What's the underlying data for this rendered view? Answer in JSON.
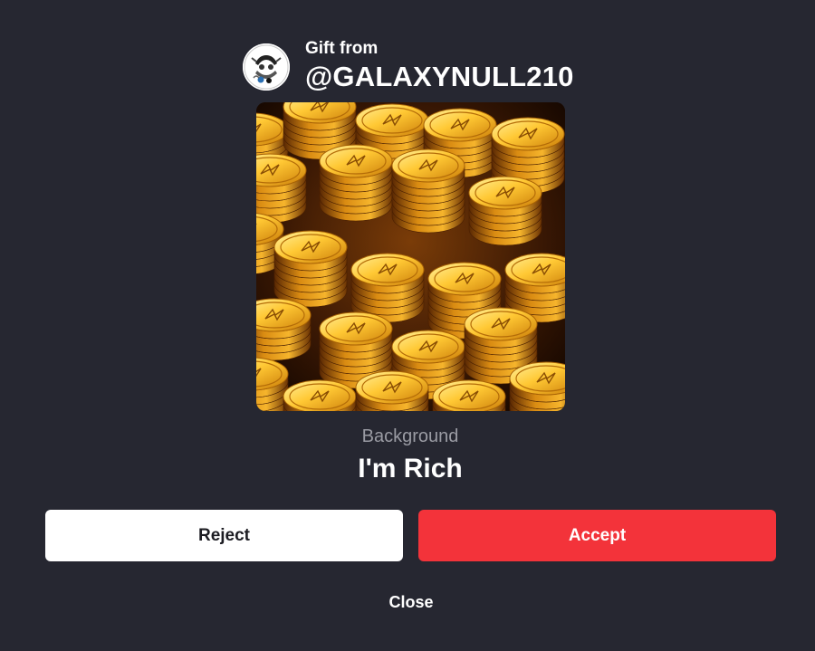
{
  "header": {
    "gift_from_label": "Gift from",
    "sender_name": "@GALAXYNULL210",
    "avatar_icon": "user-avatar-icon"
  },
  "item": {
    "type_label": "Background",
    "name": "I'm Rich",
    "image_icon": "gold-coins-background-image"
  },
  "actions": {
    "reject_label": "Reject",
    "accept_label": "Accept",
    "close_label": "Close"
  },
  "colors": {
    "background": "#262731",
    "accept": "#f3333a",
    "reject": "#ffffff",
    "muted_text": "#9a9ba3"
  }
}
